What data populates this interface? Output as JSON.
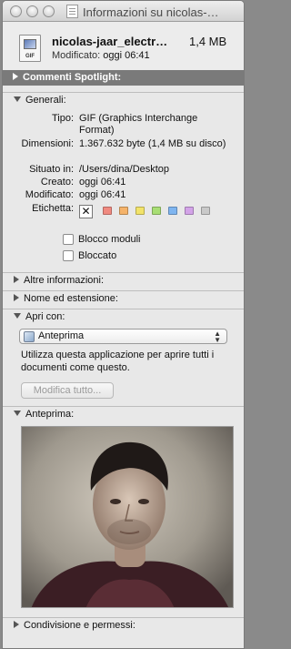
{
  "window": {
    "title": "Informazioni su nicolas-…"
  },
  "file": {
    "name": "nicolas-jaar_electr…",
    "size": "1,4 MB",
    "modified_label": "Modificato:",
    "modified_value": "oggi 06:41",
    "icon_text": "GIF"
  },
  "sections": {
    "spotlight": "Commenti Spotlight:",
    "general": "Generali:",
    "more_info": "Altre informazioni:",
    "name_ext": "Nome ed estensione:",
    "open_with": "Apri con:",
    "preview": "Anteprima:",
    "sharing": "Condivisione e permessi:"
  },
  "general": {
    "kind_label": "Tipo:",
    "kind_value": "GIF (Graphics Interchange Format)",
    "dimensions_label": "Dimensioni:",
    "dimensions_value": "1.367.632 byte (1,4 MB su disco)",
    "where_label": "Situato in:",
    "where_value": "/Users/dina/Desktop",
    "created_label": "Creato:",
    "created_value": "oggi 06:41",
    "modified_label": "Modificato:",
    "modified_value": "oggi 06:41",
    "label_label": "Etichetta:",
    "label_none_glyph": "✕",
    "label_colors": [
      "#f08a80",
      "#f5b36a",
      "#f2e36a",
      "#a8de74",
      "#7fb5f0",
      "#d3a3e8",
      "#c9c9c9"
    ],
    "stationery_label": "Blocco moduli",
    "locked_label": "Bloccato"
  },
  "open_with": {
    "app": "Anteprima",
    "arrows_up": "▲",
    "arrows_down": "▼",
    "help": "Utilizza questa applicazione per aprire tutti i documenti come questo.",
    "change_all": "Modifica tutto..."
  },
  "colors": {
    "spotlight_bar": "#7a7a7a",
    "window_bg": "#e8e8e8"
  }
}
